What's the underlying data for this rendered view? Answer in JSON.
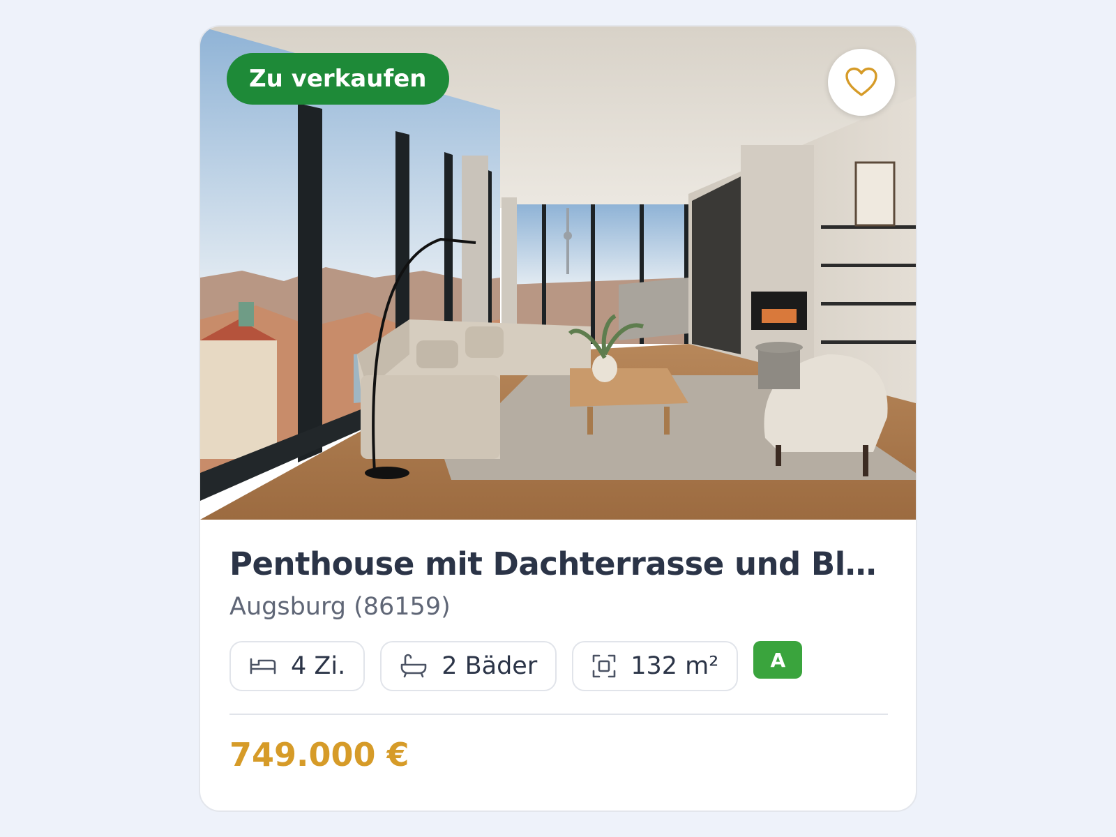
{
  "listing": {
    "status_badge": "Zu verkaufen",
    "favorite_icon": "heart-icon",
    "image_icon": "living-room-photo",
    "title": "Penthouse mit Dachterrasse und Blic…",
    "location": "Augsburg (86159)",
    "features": {
      "rooms": {
        "icon": "bed-icon",
        "label": "4 Zi."
      },
      "baths": {
        "icon": "bathtub-icon",
        "label": "2 Bäder"
      },
      "area": {
        "icon": "area-icon",
        "label": "132 m²"
      }
    },
    "energy_class": "A",
    "price": "749.000 €"
  },
  "colors": {
    "page_background": "#eef2fa",
    "status_badge": "#1e8a38",
    "favorite_icon": "#d69b28",
    "title": "#2b3447",
    "location": "#5f6676",
    "energy_class": "#3aa43d",
    "price": "#d69b28"
  }
}
